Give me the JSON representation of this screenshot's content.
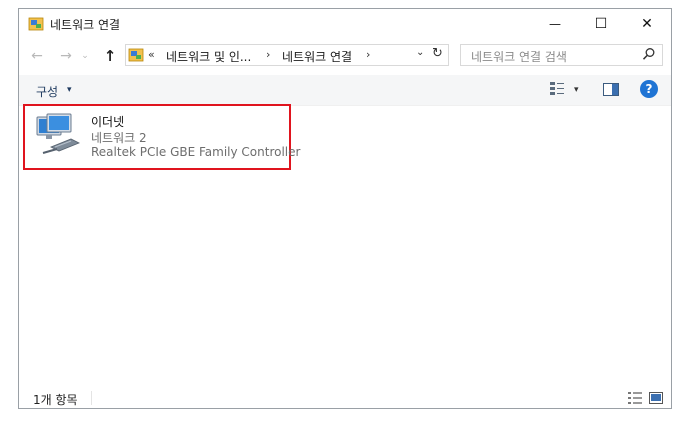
{
  "window": {
    "title": "네트워크 연결",
    "controls": {
      "minimize": "—",
      "maximize": "☐",
      "close": "✕"
    }
  },
  "nav": {
    "back": "←",
    "forward": "→",
    "recent": "⌄",
    "up": "↑"
  },
  "address": {
    "overflow": "«",
    "crumbs": [
      "네트워크 및 인...",
      "네트워크 연결"
    ],
    "separator": "›",
    "dropdown": "⌄",
    "refresh": "↻"
  },
  "search": {
    "placeholder": "네트워크 연결 검색"
  },
  "toolbar": {
    "organize": "구성",
    "caret": "▾"
  },
  "items": [
    {
      "name": "이더넷",
      "network": "네트워크 2",
      "adapter": "Realtek PCIe GBE Family Controller"
    }
  ],
  "status": {
    "count": "1개 항목"
  },
  "colors": {
    "highlight": "#e0141e",
    "help": "#1f74d4",
    "organize_text": "#1e3a5f"
  }
}
